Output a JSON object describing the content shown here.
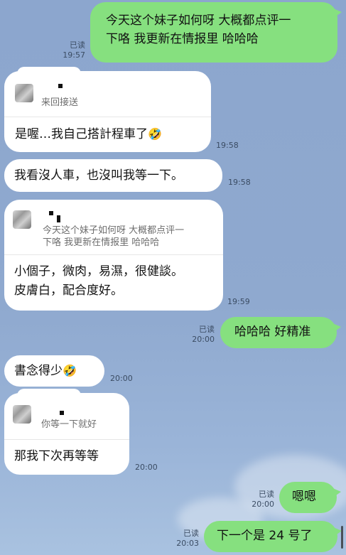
{
  "messages": [
    {
      "side": "right",
      "text_lines": [
        "今天这个妹子如何呀 大概都点评一",
        "下咯 我更新在情报里 哈哈哈"
      ],
      "read": "已读",
      "time": "19:57"
    },
    {
      "side": "left",
      "quote": "来回接送",
      "text": "是喔…我自己搭計程車了",
      "emoji": "🤣",
      "time": "19:58"
    },
    {
      "side": "left",
      "text": "我看沒人車，也沒叫我等一下。",
      "time": "19:58"
    },
    {
      "side": "left",
      "quote_lines": [
        "今天这个妹子如何呀 大概都点评一",
        "下咯 我更新在情报里 哈哈哈"
      ],
      "text_lines": [
        "小個子，微肉，易濕，很健談。",
        "皮膚白，配合度好。"
      ],
      "time": "19:59"
    },
    {
      "side": "right",
      "text": "哈哈哈 好精准",
      "read": "已读",
      "time": "20:00"
    },
    {
      "side": "left",
      "text": "書念得少",
      "emoji": "🤣",
      "time": "20:00"
    },
    {
      "side": "left",
      "quote": "你等一下就好",
      "text": "那我下次再等等",
      "time": "20:00"
    },
    {
      "side": "right",
      "text": "嗯嗯",
      "read": "已读",
      "time": "20:00"
    },
    {
      "side": "right",
      "text": "下一个是 24 号了",
      "read": "已读",
      "time": "20:03"
    }
  ],
  "colors": {
    "background": "#8ea8cc",
    "outgoing_bubble": "#86e07f",
    "incoming_bubble": "#ffffff"
  },
  "icons": {
    "avatar": "blurred-avatar-thumbnail",
    "emoji": "rolling-on-floor-laughing"
  }
}
